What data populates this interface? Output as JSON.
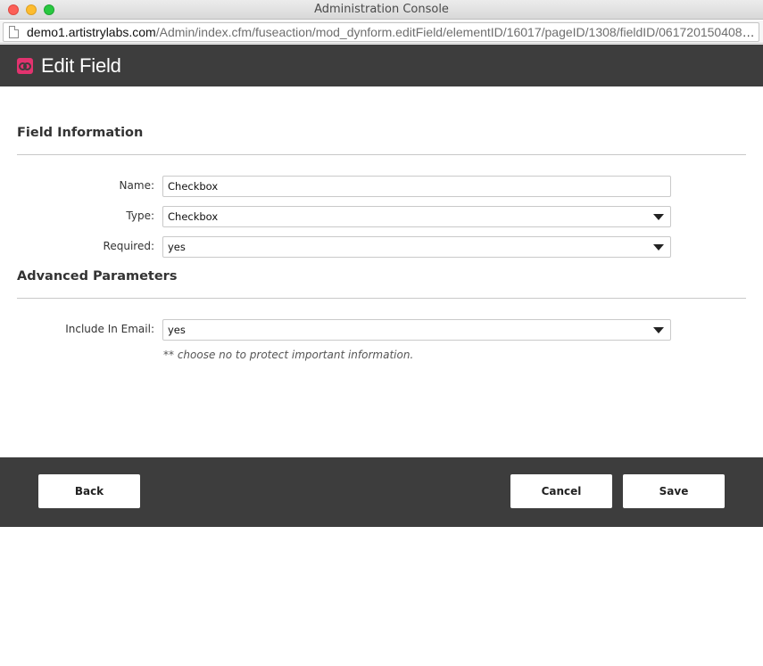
{
  "window": {
    "title": "Administration Console"
  },
  "browser": {
    "url_host": "demo1.artistrylabs.com",
    "url_path": "/Admin/index.cfm/fuseaction/mod_dynform.editField/elementID/16017/pageID/1308/fieldID/06172015040853/..."
  },
  "header": {
    "logo_icon": "artistry-logo-icon",
    "title": "Edit Field",
    "brand_color": "#e2336f",
    "bar_color": "#3d3d3d"
  },
  "field_information": {
    "heading": "Field Information",
    "name": {
      "label": "Name:",
      "value": "Checkbox"
    },
    "type": {
      "label": "Type:",
      "value": "Checkbox"
    },
    "required": {
      "label": "Required:",
      "value": "yes"
    }
  },
  "advanced": {
    "heading": "Advanced Parameters",
    "include_in_email": {
      "label": "Include In Email:",
      "value": "yes"
    },
    "hint": "** choose no to protect important information."
  },
  "footer": {
    "back_label": "Back",
    "cancel_label": "Cancel",
    "save_label": "Save"
  }
}
